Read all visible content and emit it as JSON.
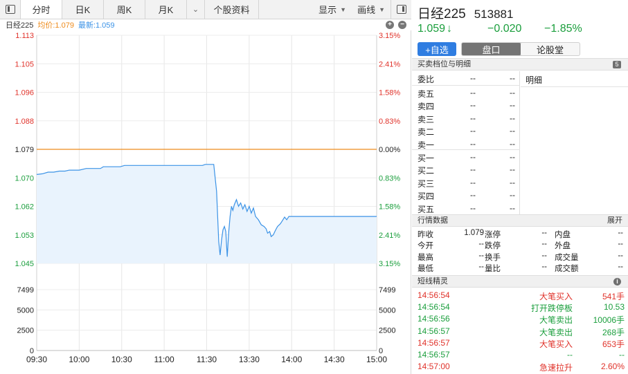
{
  "toolbar": {
    "tabs": [
      "分时",
      "日K",
      "周K",
      "月K"
    ],
    "chevron": "⌄",
    "profile": "个股资料",
    "display": "显示",
    "draw": "画线"
  },
  "legend": {
    "name": "日经225",
    "avg": "均价:1.079",
    "last": "最新:1.059",
    "plus": "+",
    "minus": "−"
  },
  "chart_data": {
    "type": "line",
    "price_axis": [
      "1.113",
      "1.105",
      "1.096",
      "1.088",
      "1.079",
      "1.070",
      "1.062",
      "1.053",
      "1.045"
    ],
    "pct_axis": [
      "3.15%",
      "2.41%",
      "1.58%",
      "0.83%",
      "0.00%",
      "0.83%",
      "1.58%",
      "2.41%",
      "3.15%"
    ],
    "volume_axis": [
      "7499",
      "5000",
      "2500",
      "0"
    ],
    "time_axis": [
      "09:30",
      "10:00",
      "10:30",
      "11:00",
      "11:30",
      "13:30",
      "14:00",
      "14:30",
      "15:00"
    ],
    "prev_close": 1.079,
    "ylim": [
      1.045,
      1.113
    ],
    "series": [
      {
        "values": [
          [
            0,
            1.0715
          ],
          [
            4,
            1.0717
          ],
          [
            8,
            1.0722
          ],
          [
            12,
            1.0722
          ],
          [
            16,
            1.0725
          ],
          [
            20,
            1.0725
          ],
          [
            23,
            1.0728
          ],
          [
            30,
            1.0728
          ],
          [
            35,
            1.0733
          ],
          [
            45,
            1.0733
          ],
          [
            47,
            1.0738
          ],
          [
            59,
            1.0738
          ],
          [
            62,
            1.0742
          ],
          [
            80,
            1.0742
          ],
          [
            90,
            1.0742
          ],
          [
            100,
            1.0742
          ],
          [
            110,
            1.0742
          ],
          [
            117,
            1.0742
          ],
          [
            119,
            1.0745
          ],
          [
            125,
            1.0745
          ],
          [
            127,
            1.0665
          ],
          [
            128.5,
            1.0515
          ],
          [
            129.5,
            1.0475
          ],
          [
            130.5,
            1.052
          ],
          [
            131.5,
            1.055
          ],
          [
            132.5,
            1.056
          ],
          [
            133.5,
            1.0545
          ],
          [
            134.5,
            1.047
          ],
          [
            135.5,
            1.054
          ],
          [
            136.5,
            1.059
          ],
          [
            137.5,
            1.062
          ],
          [
            138.5,
            1.0608
          ],
          [
            139.5,
            1.0625
          ],
          [
            141,
            1.064
          ],
          [
            142.5,
            1.062
          ],
          [
            144,
            1.063
          ],
          [
            145.5,
            1.0612
          ],
          [
            147,
            1.0625
          ],
          [
            148.5,
            1.0605
          ],
          [
            150,
            1.062
          ],
          [
            151.5,
            1.06
          ],
          [
            153,
            1.0615
          ],
          [
            154.5,
            1.059
          ],
          [
            156.5,
            1.058
          ],
          [
            158.5,
            1.0565
          ],
          [
            160.5,
            1.056
          ],
          [
            162,
            1.0553
          ],
          [
            163,
            1.054
          ],
          [
            164.5,
            1.0545
          ],
          [
            165.5,
            1.053
          ],
          [
            167,
            1.0535
          ],
          [
            168.5,
            1.0548
          ],
          [
            170,
            1.056
          ],
          [
            172,
            1.0568
          ],
          [
            173.5,
            1.0578
          ],
          [
            175,
            1.0588
          ],
          [
            176.5,
            1.058
          ],
          [
            178,
            1.059
          ],
          [
            190,
            1.059
          ],
          [
            210,
            1.059
          ],
          [
            240,
            1.059
          ]
        ]
      }
    ],
    "volume": []
  },
  "right": {
    "name": "日经225",
    "code": "513881",
    "price": "1.059",
    "arrow": "↓",
    "change": "−0.020",
    "pct": "−1.85%",
    "add_btn": "+自选",
    "seg_on": "盘口",
    "seg_off": "论股堂",
    "book_title": "买卖档位与明细",
    "book_badge": "5",
    "weibi": {
      "label": "委比",
      "v1": "--",
      "v2": "--"
    },
    "asks": [
      {
        "label": "卖五",
        "p": "--",
        "v": "--"
      },
      {
        "label": "卖四",
        "p": "--",
        "v": "--"
      },
      {
        "label": "卖三",
        "p": "--",
        "v": "--"
      },
      {
        "label": "卖二",
        "p": "--",
        "v": "--"
      },
      {
        "label": "卖一",
        "p": "--",
        "v": "--"
      }
    ],
    "bids": [
      {
        "label": "买一",
        "p": "--",
        "v": "--"
      },
      {
        "label": "买二",
        "p": "--",
        "v": "--"
      },
      {
        "label": "买三",
        "p": "--",
        "v": "--"
      },
      {
        "label": "买四",
        "p": "--",
        "v": "--"
      },
      {
        "label": "买五",
        "p": "--",
        "v": "--"
      }
    ],
    "detail": "明细",
    "mkt_title": "行情数据",
    "mkt_expand": "展开",
    "mkt": [
      {
        "a": "昨收",
        "av": "1.079",
        "b": "涨停",
        "bv": "--",
        "c": "内盘",
        "cv": "--"
      },
      {
        "a": "今开",
        "av": "--",
        "b": "跌停",
        "bv": "--",
        "c": "外盘",
        "cv": "--"
      },
      {
        "a": "最高",
        "av": "--",
        "b": "换手",
        "bv": "--",
        "c": "成交量",
        "cv": "--"
      },
      {
        "a": "最低",
        "av": "--",
        "b": "量比",
        "bv": "--",
        "c": "成交额",
        "cv": "--"
      }
    ],
    "ticks_title": "短线精灵",
    "ticks_info": "i",
    "ticks": [
      {
        "time": "14:56:54",
        "event": "大笔买入",
        "value": "541手",
        "color": "red"
      },
      {
        "time": "14:56:54",
        "event": "打开跌停板",
        "value": "10.53",
        "color": "green"
      },
      {
        "time": "14:56:56",
        "event": "大笔卖出",
        "value": "10006手",
        "color": "green"
      },
      {
        "time": "14:56:57",
        "event": "大笔卖出",
        "value": "268手",
        "color": "green"
      },
      {
        "time": "14:56:57",
        "event": "大笔买入",
        "value": "653手",
        "color": "red"
      },
      {
        "time": "14:56:57",
        "event": "--",
        "value": "--",
        "color": "green"
      },
      {
        "time": "14:57:00",
        "event": "急速拉升",
        "value": "2.60%",
        "color": "red"
      }
    ]
  },
  "colors": {
    "up": "#e0322a",
    "down": "#1a9e3c",
    "price_line": "#3a92e6",
    "avg_line": "#ee8a1a",
    "area_fill": "#e9f3fd"
  }
}
